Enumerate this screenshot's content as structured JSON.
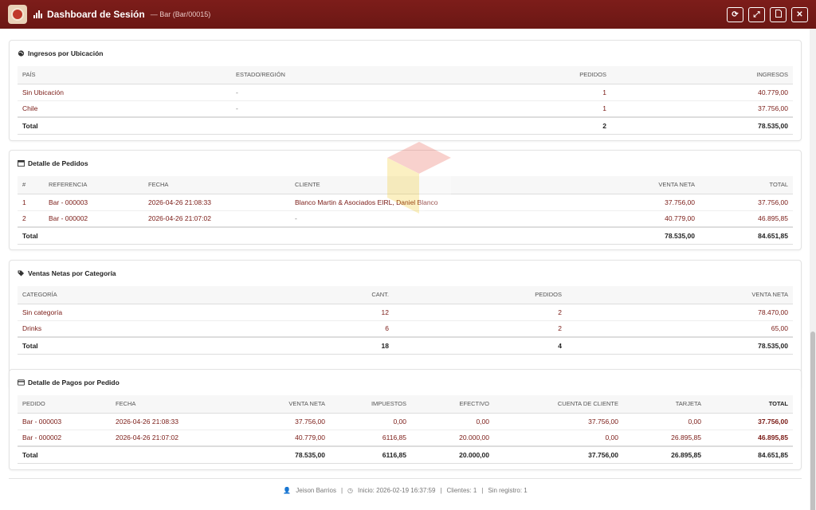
{
  "header": {
    "title": "Dashboard de Sesión",
    "subtitle": "— Bar (Bar/00015)",
    "actions": [
      "refresh-icon",
      "expand-icon",
      "pdf-icon",
      "close-icon"
    ]
  },
  "ubicacion": {
    "title": "Ingresos por Ubicación",
    "columns": [
      "PAÍS",
      "ESTADO/REGIÓN",
      "PEDIDOS",
      "INGRESOS"
    ],
    "rows": [
      {
        "pais": "Sin Ubicación",
        "region": "-",
        "pedidos": "1",
        "ingresos": "40.779,00"
      },
      {
        "pais": "Chile",
        "region": "-",
        "pedidos": "1",
        "ingresos": "37.756,00"
      }
    ],
    "total": {
      "label": "Total",
      "pedidos": "2",
      "ingresos": "78.535,00"
    }
  },
  "pedidos": {
    "title": "Detalle de Pedidos",
    "columns": [
      "#",
      "REFERENCIA",
      "FECHA",
      "CLIENTE",
      "VENTA NETA",
      "TOTAL"
    ],
    "rows": [
      {
        "n": "1",
        "ref": "Bar - 000003",
        "fecha": "2026-04-26 21:08:33",
        "cliente": "Blanco Martin & Asociados EIRL, Daniel Blanco",
        "neta": "37.756,00",
        "total": "37.756,00"
      },
      {
        "n": "2",
        "ref": "Bar - 000002",
        "fecha": "2026-04-26 21:07:02",
        "cliente": "-",
        "neta": "40.779,00",
        "total": "46.895,85"
      }
    ],
    "total": {
      "label": "Total",
      "neta": "78.535,00",
      "total": "84.651,85"
    }
  },
  "categorias": {
    "title": "Ventas Netas por Categoría",
    "columns": [
      "CATEGORÍA",
      "CANT.",
      "PEDIDOS",
      "VENTA NETA"
    ],
    "rows": [
      {
        "cat": "Sin categoría",
        "cant": "12",
        "pedidos": "2",
        "neta": "78.470,00"
      },
      {
        "cat": "Drinks",
        "cant": "6",
        "pedidos": "2",
        "neta": "65,00"
      }
    ],
    "total": {
      "label": "Total",
      "cant": "18",
      "pedidos": "4",
      "neta": "78.535,00"
    }
  },
  "pagos": {
    "title": "Detalle de Pagos por Pedido",
    "columns": [
      "PEDIDO",
      "FECHA",
      "VENTA NETA",
      "IMPUESTOS",
      "EFECTIVO",
      "CUENTA DE CLIENTE",
      "TARJETA",
      "TOTAL"
    ],
    "rows": [
      {
        "pedido": "Bar - 000003",
        "fecha": "2026-04-26 21:08:33",
        "neta": "37.756,00",
        "imp": "0,00",
        "efe": "0,00",
        "cuenta": "37.756,00",
        "tarjeta": "0,00",
        "total": "37.756,00"
      },
      {
        "pedido": "Bar - 000002",
        "fecha": "2026-04-26 21:07:02",
        "neta": "40.779,00",
        "imp": "6116,85",
        "efe": "20.000,00",
        "cuenta": "0,00",
        "tarjeta": "26.895,85",
        "total": "46.895,85"
      }
    ],
    "total": {
      "label": "Total",
      "neta": "78.535,00",
      "imp": "6116,85",
      "efe": "20.000,00",
      "cuenta": "37.756,00",
      "tarjeta": "26.895,85",
      "total": "84.651,85"
    }
  },
  "footer": {
    "user": "Jeison Barrios",
    "inicio": "Inicio: 2026-02-19 16:37:59",
    "clientes": "Clientes: 1",
    "sinregistro": "Sin registro: 1",
    "sep": "|"
  }
}
